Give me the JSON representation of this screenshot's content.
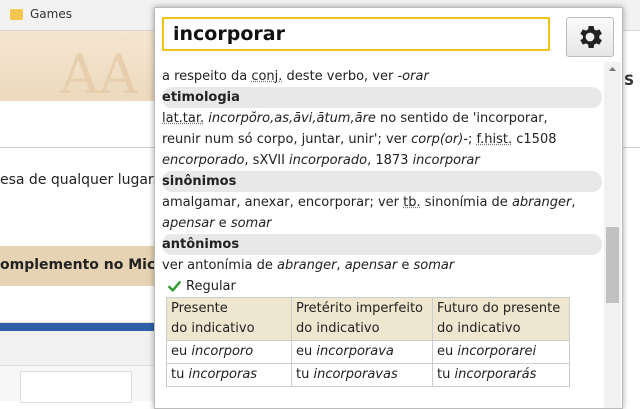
{
  "bookmarks": {
    "item": "Games"
  },
  "background": {
    "text_line": "esa de qualquer lugar.",
    "section_title": "omplemento no Mic"
  },
  "popup": {
    "search_value": "incorporar",
    "line1_pre": "a respeito da ",
    "line1_abbr": "conj.",
    "line1_mid": " deste verbo, ver ",
    "line1_em": "-orar",
    "etimologia": {
      "header": "etimologia",
      "l1_abbr": "lat.tar.",
      "l1_em": "incorpŏro,as,āvi,ātum,āre",
      "l1_rest": " no sentido de 'incorporar,",
      "l2_a": "reunir num só corpo, juntar, unir'; ver ",
      "l2_em": "corp(or)-",
      "l2_b": "; ",
      "l2_abbr": "f.hist.",
      "l2_c": " c1508",
      "l3_em1": "encorporado",
      "l3_a": ", sXVII ",
      "l3_em2": "incorporado",
      "l3_b": ", 1873 ",
      "l3_em3": "incorporar"
    },
    "sinonimos": {
      "header": "sinônimos",
      "l1_a": "amalgamar, anexar, encorporar; ver ",
      "l1_abbr": "tb.",
      "l1_b": " sinonímia de ",
      "l1_em": "abranger",
      "l2_em1": "apensar",
      "l2_a": " e ",
      "l2_em2": "somar"
    },
    "antonimos": {
      "header": "antônimos",
      "l1_a": "ver antonímia de ",
      "l1_em1": "abranger",
      "l1_b": ", ",
      "l1_em2": "apensar",
      "l1_c": " e ",
      "l1_em3": "somar"
    },
    "regular_label": "Regular",
    "table": {
      "headers": [
        [
          "Presente",
          "do indicativo"
        ],
        [
          "Pretérito imperfeito",
          "do indicativo"
        ],
        [
          "Futuro do presente",
          "do indicativo"
        ]
      ],
      "rows": [
        [
          {
            "p": "eu",
            "v": "incorporo"
          },
          {
            "p": "eu",
            "v": "incorporava"
          },
          {
            "p": "eu",
            "v": "incorporarei"
          }
        ],
        [
          {
            "p": "tu",
            "v": "incorporas"
          },
          {
            "p": "tu",
            "v": "incorporavas"
          },
          {
            "p": "tu",
            "v": "incorporarás"
          }
        ]
      ]
    }
  },
  "colors": {
    "search_border": "#f0c419",
    "header_bg": "#e8e8e8",
    "table_header_bg": "#efe6cf",
    "check": "#2e9a2e"
  },
  "icons": {
    "settings": "gear-icon",
    "regular": "checkmark-icon",
    "folder": "folder-icon"
  }
}
